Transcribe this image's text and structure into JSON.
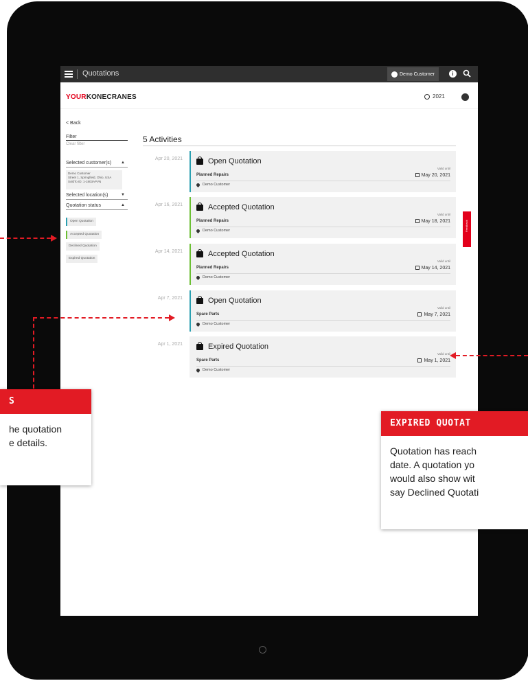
{
  "topbar": {
    "title": "Quotations",
    "customer": "Demo Customer",
    "info_glyph": "i"
  },
  "header": {
    "logo_your": "YOUR",
    "logo_brand": "KONECRANES",
    "year": "2021"
  },
  "sidebar": {
    "back": "< Back",
    "filter_label": "Filter",
    "filter_placeholder": "Clear filter",
    "selected_customers": "Selected customer(s)",
    "customer_details": "Demo Customer\nStreet 1, Springfield, Ohio, USA\nSoldTo ID: 1-1803APVN",
    "selected_locations": "Selected location(s)",
    "quotation_status": "Quotation status",
    "statuses": [
      "Open Quotation",
      "Accepted Quotation",
      "Declined Quotation",
      "Expired Quotation"
    ]
  },
  "activities": {
    "title": "5 Activities",
    "valid_until_label": "Valid until",
    "items": [
      {
        "date": "Apr 20, 2021",
        "title": "Open Quotation",
        "type": "Planned Repairs",
        "valid": "May 20, 2021",
        "customer": "Demo Customer",
        "status_color": "#2a9fb0"
      },
      {
        "date": "Apr 16, 2021",
        "title": "Accepted Quotation",
        "type": "Planned Repairs",
        "valid": "May 18, 2021",
        "customer": "Demo Customer",
        "status_color": "#6bbf33"
      },
      {
        "date": "Apr 14, 2021",
        "title": "Accepted Quotation",
        "type": "Planned Repairs",
        "valid": "May 14, 2021",
        "customer": "Demo Customer",
        "status_color": "#6bbf33"
      },
      {
        "date": "Apr 7, 2021",
        "title": "Open Quotation",
        "type": "Spare Parts",
        "valid": "May 7, 2021",
        "customer": "Demo Customer",
        "status_color": "#2a9fb0"
      },
      {
        "date": "Apr 1, 2021",
        "title": "Expired Quotation",
        "type": "Spare Parts",
        "valid": "May 1, 2021",
        "customer": "Demo Customer",
        "status_color": "#f1f1f1"
      }
    ]
  },
  "feedback": "Feedback",
  "callouts": {
    "left_head": "S",
    "left_body": "he quotation\ne details.",
    "right_head": "EXPIRED QUOTAT",
    "right_body": "Quotation has reach\ndate. A quotation yo\nwould also show wit\nsay Declined Quotati"
  },
  "colors": {
    "accent": "#e21b24",
    "brand_red": "#e3001b",
    "open": "#2a9fb0",
    "accepted": "#6bbf33"
  }
}
